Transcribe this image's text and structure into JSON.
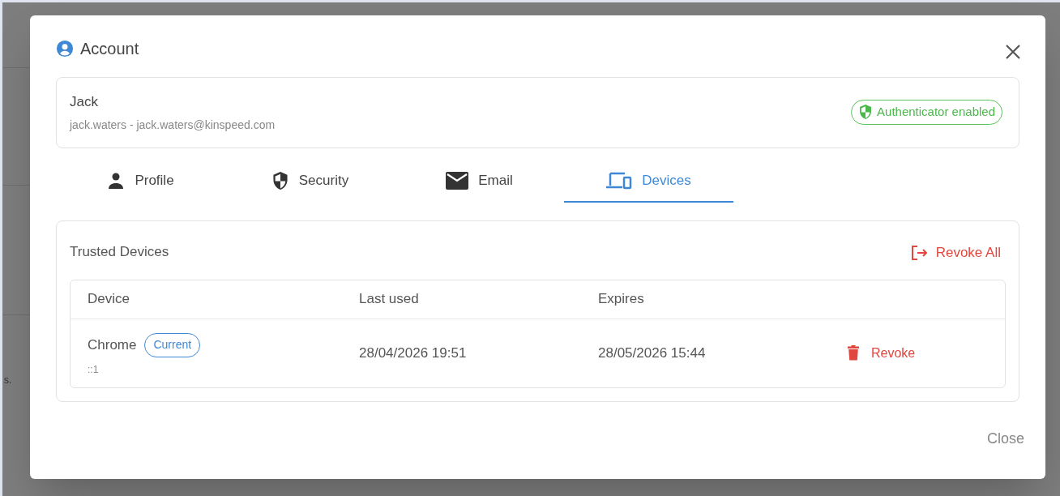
{
  "background_text": "s.",
  "dialog": {
    "title": "Account",
    "close_label": "Close"
  },
  "user": {
    "name": "Jack",
    "details": "jack.waters - jack.waters@kinspeed.com",
    "badge": "Authenticator enabled"
  },
  "tabs": [
    {
      "label": "Profile",
      "kind": "person",
      "selected": false
    },
    {
      "label": "Security",
      "kind": "shield",
      "selected": false
    },
    {
      "label": "Email",
      "kind": "mail",
      "selected": false
    },
    {
      "label": "Devices",
      "kind": "devices",
      "selected": true
    }
  ],
  "trusted_devices": {
    "title": "Trusted Devices",
    "revoke_all": "Revoke All",
    "columns": [
      "Device",
      "Last used",
      "Expires"
    ],
    "rows": [
      {
        "device": "Chrome",
        "current": true,
        "current_label": "Current",
        "address": "::1",
        "last_used": "28/04/2026 19:51",
        "expires": "28/05/2026 15:44",
        "action": "Revoke"
      }
    ]
  }
}
